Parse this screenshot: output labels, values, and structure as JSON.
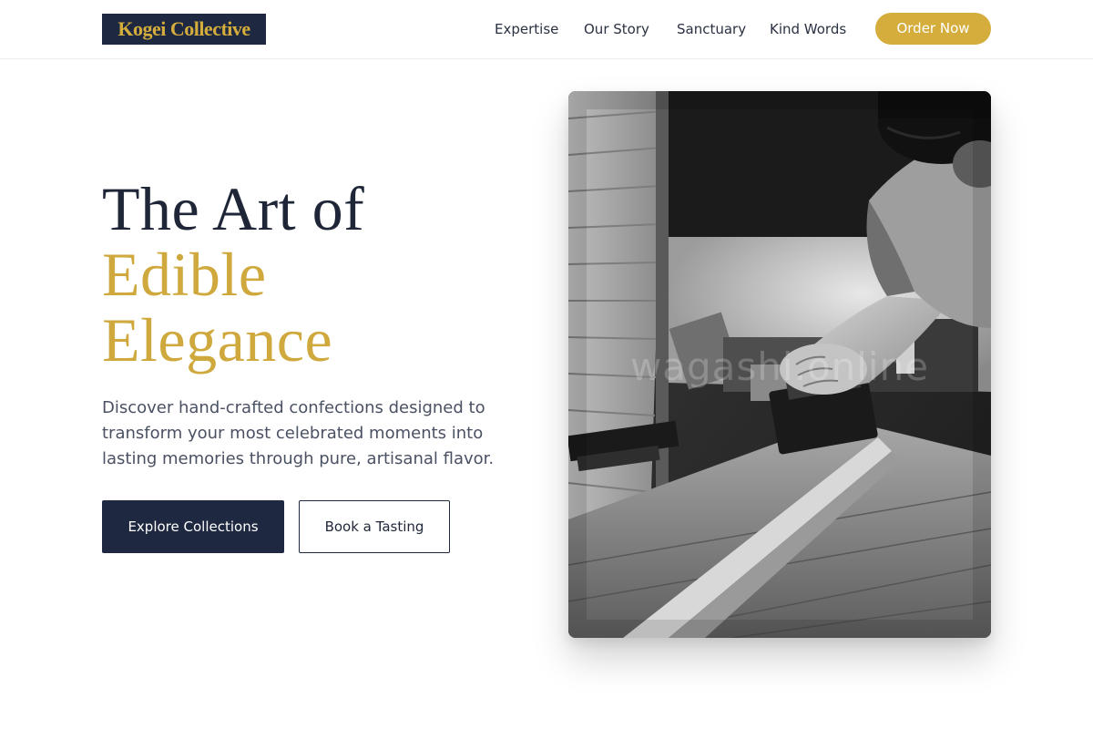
{
  "brand": {
    "name": "Kogei Collective",
    "colors": {
      "navy": "#1e2840",
      "gold": "#d4ad3c",
      "text_muted": "#4a5163"
    }
  },
  "nav": {
    "items": [
      {
        "label": "Expertise"
      },
      {
        "label": "Our Story"
      },
      {
        "label": "Sanctuary"
      },
      {
        "label": "Kind Words"
      }
    ],
    "cta_label": "Order Now"
  },
  "hero": {
    "title_line1": "The Art of",
    "title_line2": "Edible",
    "title_line3": "Elegance",
    "subtitle": "Discover hand-crafted confections designed to transform your most celebrated moments into lasting memories through pure, artisanal flavor.",
    "primary_button": "Explore Collections",
    "secondary_button": "Book a Tasting"
  },
  "image": {
    "subject": "black-and-white photo of a craftsman planing wood in a workshop",
    "watermark": "wagashi.online"
  }
}
